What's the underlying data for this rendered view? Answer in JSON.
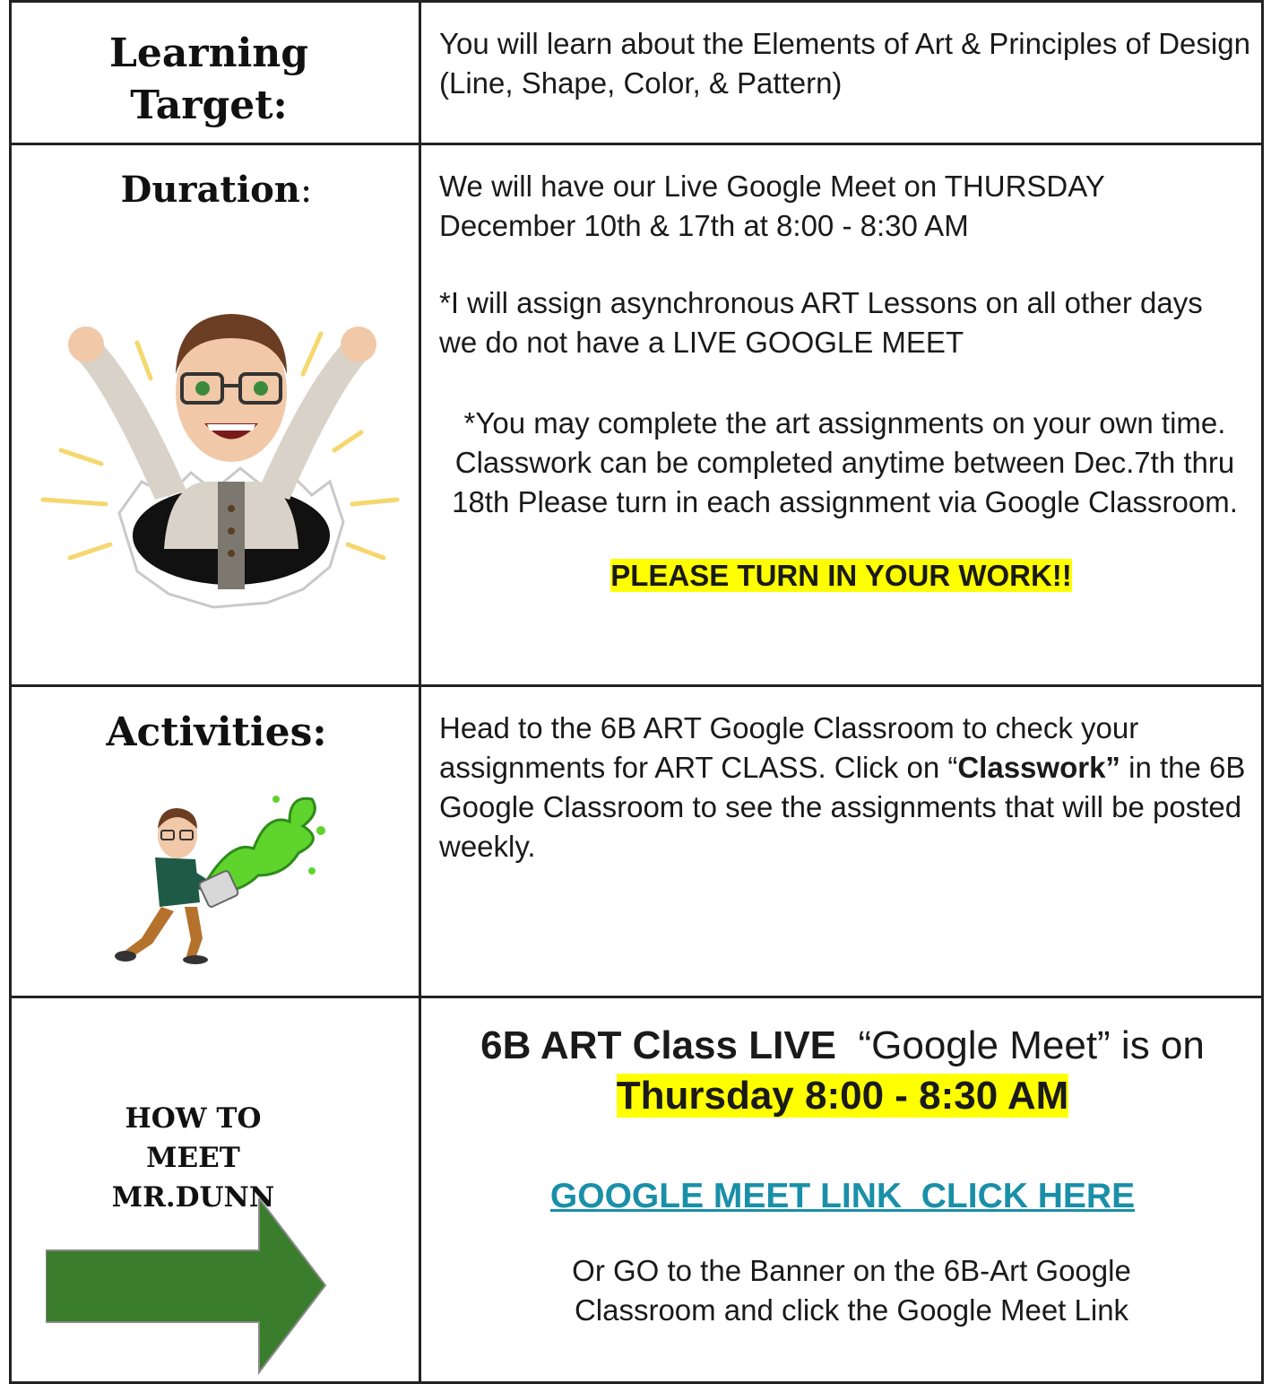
{
  "rows": {
    "learning": {
      "heading": "Learning Target:",
      "text": "You will learn about the Elements of Art & Principles of Design (Line, Shape, Color, & Pattern)"
    },
    "duration": {
      "heading": "Duration",
      "colon": ":",
      "p1": "We will have our Live Google Meet on THURSDAY December 10th & 17th at 8:00 - 8:30 AM",
      "p2": "*I will assign asynchronous ART Lessons on all other days we do not have a LIVE GOOGLE MEET",
      "p3": "*You may complete the art assignments on your own time. Classwork can be completed anytime between Dec.7th thru 18th Please turn in each assignment via Google Classroom.",
      "highlight": "PLEASE TURN IN YOUR WORK!!"
    },
    "activities": {
      "heading": "Activities:",
      "text_a": "Head to the 6B ART Google Classroom to check your assignments for ART CLASS. Click on “",
      "text_bold": "Classwork”",
      "text_b": " in the 6B Google Classroom to see the assignments that will be posted weekly."
    },
    "meet": {
      "heading_line1": "HOW TO",
      "heading_line2": "MEET",
      "heading_line3": "MR.DUNN",
      "title_bold": "6B ART Class LIVE",
      "title_rest": "  “Google Meet” is on",
      "time": "Thursday 8:00 - 8:30 AM",
      "link": "GOOGLE MEET LINK  CLICK HERE",
      "note": "Or GO to the Banner on the 6B-Art Google Classroom and click the Google Meet Link"
    }
  },
  "colors": {
    "highlight": "#ffff00",
    "link": "#1a8fa8",
    "arrow": "#3a7d2c",
    "border": "#222222"
  },
  "icons": {
    "bitmoji_cheer": "bitmoji-bursting-through-paper",
    "bitmoji_paint": "bitmoji-throwing-green-paint",
    "arrow": "green-right-arrow"
  }
}
